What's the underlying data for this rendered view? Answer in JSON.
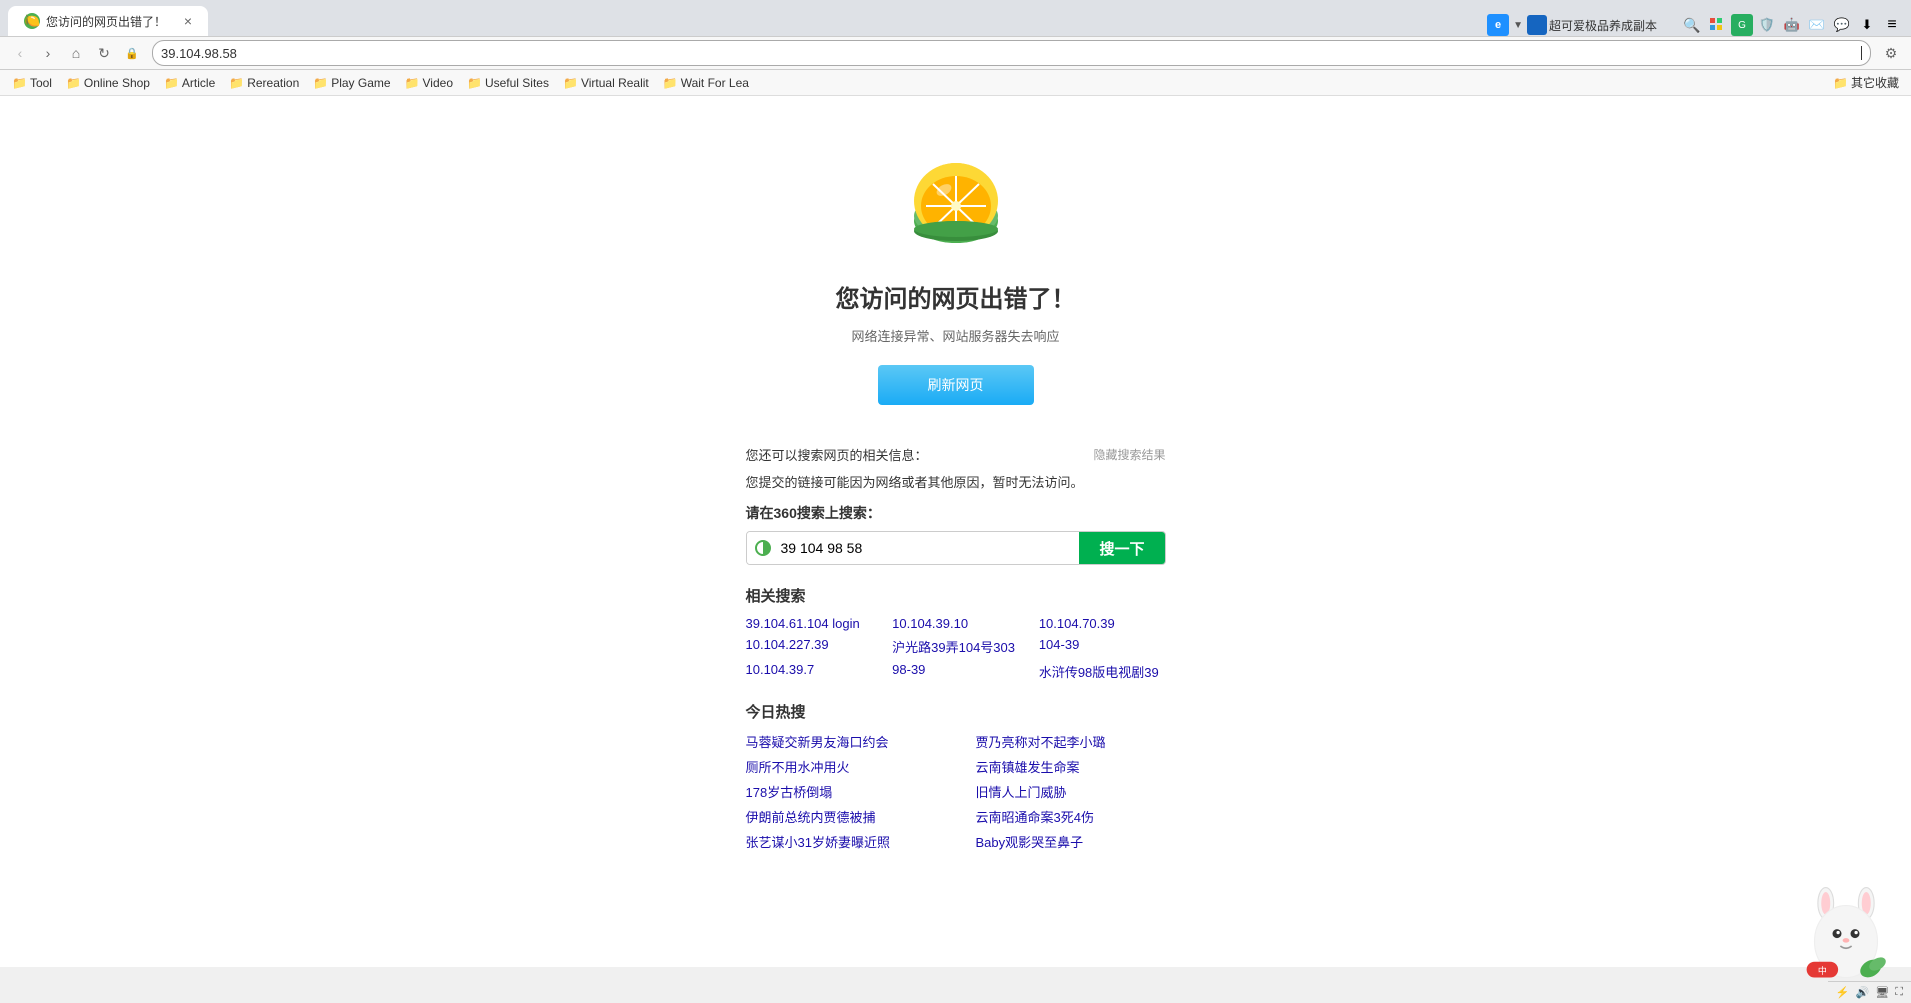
{
  "browser": {
    "url": "39.104.98.58",
    "tab_title": "您访问的网页出错了！",
    "tab_favicon": "🍋"
  },
  "bookmarks": {
    "items": [
      {
        "label": "Tool",
        "icon": "📁"
      },
      {
        "label": "Online Shop",
        "icon": "📁"
      },
      {
        "label": "Article",
        "icon": "📁"
      },
      {
        "label": "Rereation",
        "icon": "📁"
      },
      {
        "label": "Play Game",
        "icon": "📁"
      },
      {
        "label": "Video",
        "icon": "📁"
      },
      {
        "label": "Useful Sites",
        "icon": "📁"
      },
      {
        "label": "Virtual Realit",
        "icon": "📁"
      },
      {
        "label": "Wait For Lea",
        "icon": "📁"
      }
    ],
    "right_label": "其它收藏"
  },
  "page": {
    "error_title": "您访问的网页出错了！",
    "error_subtitle": "网络连接异常、网站服务器失去响应",
    "refresh_button": "刷新网页",
    "search_info_label": "您还可以搜索网页的相关信息：",
    "hide_label": "隐藏搜索结果",
    "link_info": "您提交的链接可能因为网络或者其他原因，暂时无法访问。",
    "search_prompt": "请在360搜索上搜索：",
    "search_placeholder": "39 104 98 58",
    "search_button": "搜一下",
    "related_title": "相关搜索",
    "related_links": [
      "39.104.61.104 login",
      "10.104.39.10",
      "10.104.70.39",
      "10.104.227.39",
      "沪光路39弄104号303",
      "104-39",
      "10.104.39.7",
      "98-39",
      "水浒传98版电视剧39"
    ],
    "hot_title": "今日热搜",
    "hot_links": [
      "马蓉疑交新男友海口约会",
      "贾乃亮称对不起李小璐",
      "厕所不用水冲用火",
      "云南镇雄发生命案",
      "178岁古桥倒塌",
      "旧情人上门威胁",
      "伊朗前总统内贾德被捕",
      "云南昭通命案3死4伤",
      "张艺谋小31岁娇妻曝近照",
      "Baby观影哭至鼻子"
    ]
  },
  "top_right": {
    "extension_label": "超可爱极品养成副本"
  }
}
